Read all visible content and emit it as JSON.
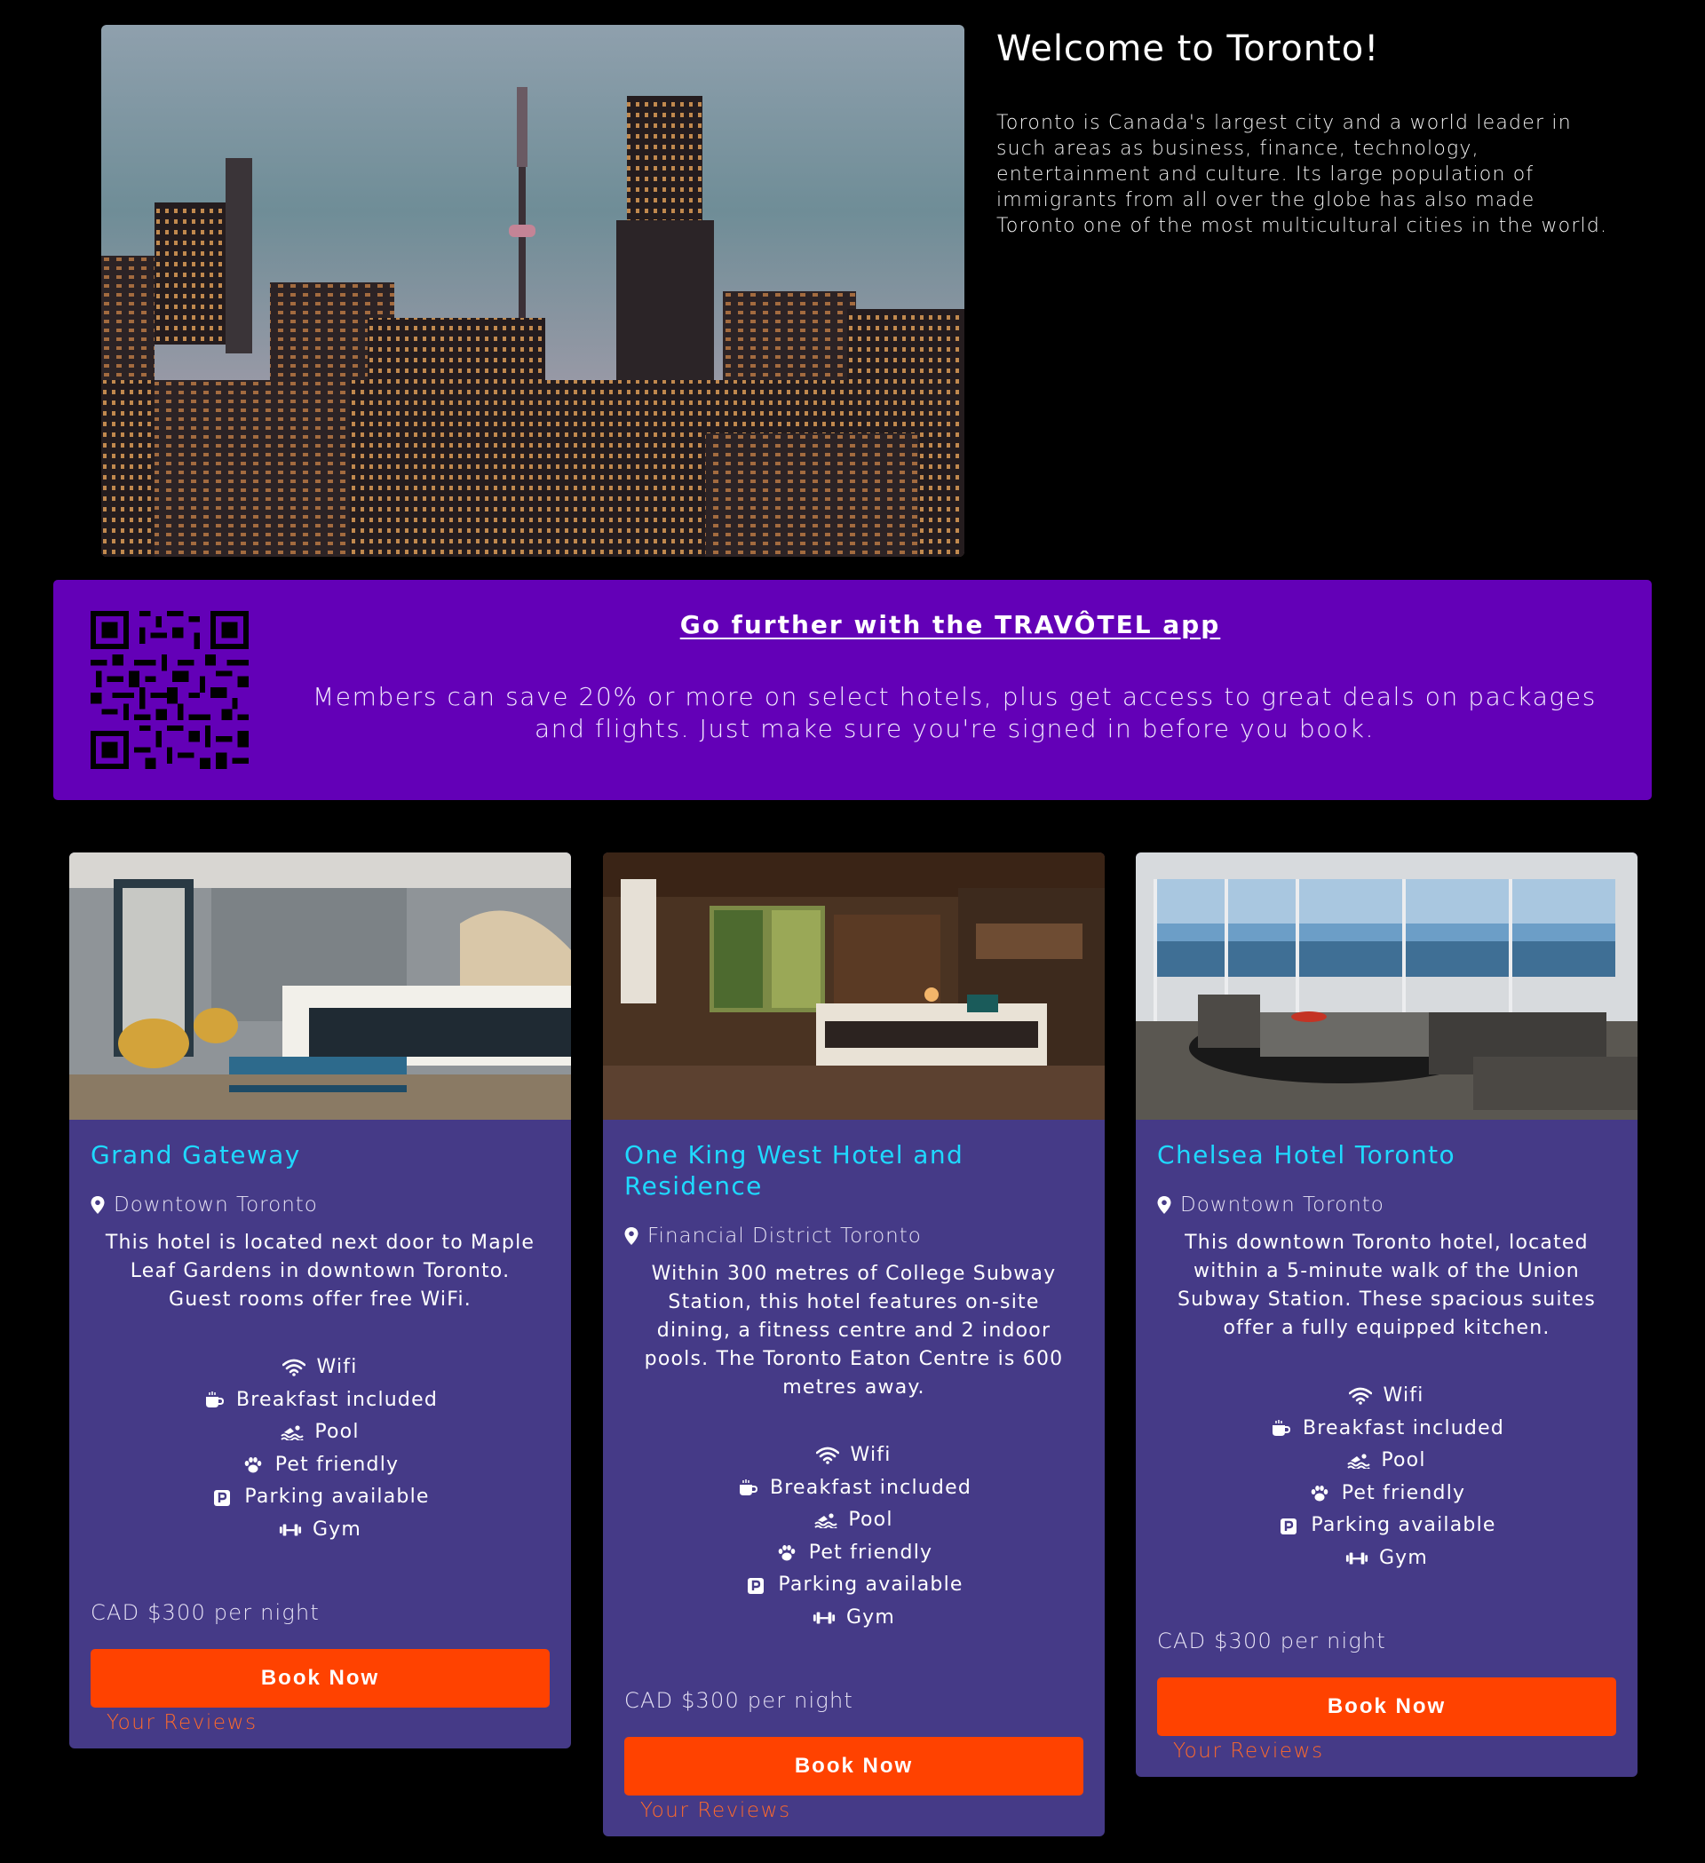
{
  "intro": {
    "title": "Welcome to Toronto!",
    "description": "Toronto is Canada's largest city and a world leader in such areas as business, finance, technology, entertainment and culture. Its large population of immigrants from all over the globe has also made Toronto one of the most multicultural cities in the world."
  },
  "app_banner": {
    "title": "Go further with the TRAVÔTEL app",
    "text": "Members can save 20% or more on select hotels, plus get access to great deals on packages and flights. Just make sure you're signed in before you book.",
    "bg_color": "#6300b7"
  },
  "colors": {
    "card_bg": "#453a87",
    "hotel_name": "#1fd9ff",
    "button": "#ff4200",
    "reviews_link": "#ff6a2a"
  },
  "hotels": [
    {
      "name": "Grand Gateway",
      "location": "Downtown Toronto",
      "description": "This hotel is located next door to Maple Leaf Gardens in downtown Toronto. Guest rooms offer free WiFi.",
      "amenities": [
        {
          "icon": "wifi-icon",
          "label": "Wifi"
        },
        {
          "icon": "coffee-icon",
          "label": "Breakfast included"
        },
        {
          "icon": "swimmer-icon",
          "label": "Pool"
        },
        {
          "icon": "paw-icon",
          "label": "Pet friendly"
        },
        {
          "icon": "parking-icon",
          "label": "Parking available"
        },
        {
          "icon": "dumbbell-icon",
          "label": "Gym"
        }
      ],
      "price": "CAD $300 per night",
      "book_label": "Book Now",
      "reviews_label": "Your Reviews"
    },
    {
      "name": "One King West Hotel and Residence",
      "location": "Financial District Toronto",
      "description": "Within 300 metres of College Subway Station, this hotel features on-site dining, a fitness centre and 2 indoor pools. The Toronto Eaton Centre is 600 metres away.",
      "amenities": [
        {
          "icon": "wifi-icon",
          "label": "Wifi"
        },
        {
          "icon": "coffee-icon",
          "label": "Breakfast included"
        },
        {
          "icon": "swimmer-icon",
          "label": "Pool"
        },
        {
          "icon": "paw-icon",
          "label": "Pet friendly"
        },
        {
          "icon": "parking-icon",
          "label": "Parking available"
        },
        {
          "icon": "dumbbell-icon",
          "label": "Gym"
        }
      ],
      "price": "CAD $300 per night",
      "book_label": "Book Now",
      "reviews_label": "Your Reviews"
    },
    {
      "name": "Chelsea Hotel Toronto",
      "location": "Downtown Toronto",
      "description": "This downtown Toronto hotel, located within a 5-minute walk of the Union Subway Station. These spacious suites offer a fully equipped kitchen.",
      "amenities": [
        {
          "icon": "wifi-icon",
          "label": "Wifi"
        },
        {
          "icon": "coffee-icon",
          "label": "Breakfast included"
        },
        {
          "icon": "swimmer-icon",
          "label": "Pool"
        },
        {
          "icon": "paw-icon",
          "label": "Pet friendly"
        },
        {
          "icon": "parking-icon",
          "label": "Parking available"
        },
        {
          "icon": "dumbbell-icon",
          "label": "Gym"
        }
      ],
      "price": "CAD $300 per night",
      "book_label": "Book Now",
      "reviews_label": "Your Reviews"
    }
  ]
}
